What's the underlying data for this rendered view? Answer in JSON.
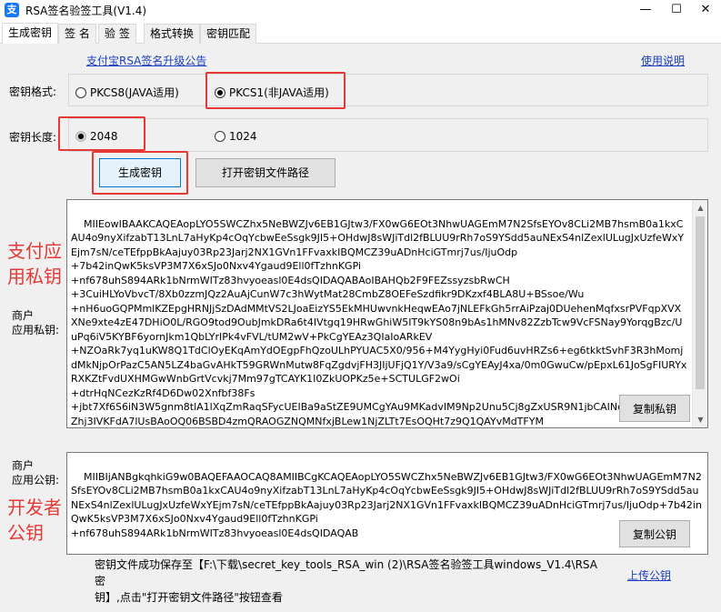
{
  "window": {
    "title": "RSA签名验签工具(V1.4)",
    "minimize": "—",
    "maximize": "☐",
    "close": "✕"
  },
  "tabs": [
    "生成密钥",
    "签  名",
    "验  签",
    "格式转换",
    "密钥匹配"
  ],
  "links": {
    "upgrade_notice": "支付宝RSA签名升级公告",
    "manual": "使用说明",
    "upload": "上传公钥"
  },
  "key_format": {
    "label": "密钥格式:",
    "options": [
      "PKCS8(JAVA适用)",
      "PKCS1(非JAVA适用)"
    ],
    "selected": "PKCS1(非JAVA适用)"
  },
  "key_length": {
    "label": "密钥长度:",
    "options": [
      "2048",
      "1024"
    ],
    "selected": "2048"
  },
  "buttons": {
    "generate": "生成密钥",
    "open_path": "打开密钥文件路径",
    "copy_private": "复制私钥",
    "copy_public": "复制公钥"
  },
  "private_key": {
    "label_line1": "商户",
    "label_line2": "应用私钥:",
    "value": "MIIEowIBAAKCAQEAopLYO5SWCZhx5NeBWZJv6EB1GJtw3/FX0wG6EOt3NhwUAGEmM7N2SfsEYOv8CLi2MB7hsmB0a1kxCAU4o9nyXifzabT13LnL7aHyKp4cOqYcbwEeSsgk9JI5+OHdwJ8sWJiTdl2fBLUU9rRh7oS9YSdd5auNExS4nlZexlULugJxUzfeWxYEjm7sN/ceTEfppBkAajuy03Rp23Jarj2NX1GVn1FFvaxkIBQMCZ39uADnHciGTmrj7us/IjuOdp\n+7b42inQwK5ksVP3M7X6xSJo0Nxv4Ygaud9Ell0fTzhnKGPi\n+nf678uhS894ARk1bNrmWITz83hvyoeasl0E4dsQIDAQABAoIBAHQb2F9FEZssyzsbRwCH\n+3CuiHLYoVbvcT/8Xb0zzmJQz2AuAjCunW7c3hWytMat28CmbZ8OEFeSzdfikr9DKzxf4BLA8U+BSsoe/Wu\n+nH6uoGQPMmlKZEpgHRNJjSzDAdMMtVS2LJoaEizYS5EkMHUwvnkHeqwEAo7jNLEFkGh5rrAiPzaj0DUehenMqfxsrPVFqpXVXXNe9xte4zE47DHiO0L/RGO9tod9OubJmkDRa6t4IVtgq19HRwGhiW5IT9kYS08n9bAs1hMNv82ZzbTcw9VcFSNay9YorqgBzc/UuPq6iV5KYBF6yornJkm1QbLYrIPk4vFVL/tUM2wV+PkCgYEAz3QIaIoARkEV\n+NZOaRk7yq1uKW8Q1TdClOyEKqAmYdOEgpFhQzoULhPYUAC5X0/956+M4YygHyi0Fud6uvHRZs6+eg6tkktSvhF3R3hMomjdMkNjpOrPazC5AN5LZ4baGvAHkT59GRWnMutw8FqZgdvjFH3JIjUFjQ1Y/V3a9/sCgYEAyJ4xa/0m0GwuCw/pEpxL61JoSgFIURYxRXKZtFvdUXHMGwWnbGrtVcvkj7Mm97gTCAYK1I0ZkUOPKz5e+SCTULGF2wOi\n+dtrHqNCezKzRf4D6Dw02Xnfbf38Fs\n+jbt7Xf6S6iN3W5gnm8tlA1lXqZmRaqSFycUEIBa9aStZE9UMCgYAu9MKadvIM9Np2Unu5Cj8gZxUSR9N1jbCAINcPgJZs/uroxkZhj3IVKFdA7lUsBAoOQ06BSBD4zmQRAOGZNQMNfxjBLew1NjZLTt7EsOQHt7z9Q1QAYvMdTFYM"
  },
  "public_key": {
    "label_line1": "商户",
    "label_line2": "应用公钥:",
    "value": "MIIBIjANBgkqhkiG9w0BAQEFAAOCAQ8AMIIBCgKCAQEAopLYO5SWCZhx5NeBWZJv6EB1GJtw3/FX0wG6EOt3NhwUAGEmM7N2SfsEYOv8CLi2MB7hsmB0a1kxCAU4o9nyXifzabT13LnL7aHyKp4cOqYcbwEeSsgk9JI5+OHdwJ8sWJiTdl2fBLUU9rRh7oS9YSdd5auNExS4nlZexlULugJxUzfeWxYEjm7sN/ceTEfppBkAajuy03Rp23Jarj2NX1GVn1FFvaxkIBQMCZ39uADnHciGTmrj7us/IjuOdp+7b42inQwK5ksVP3M7X6xSJo0Nxv4Ygaud9Ell0fTzhnKGPi\n+nf678uhS894ARk1bNrmWITz83hvyoeasl0E4dsQIDAQAB"
  },
  "annotations": {
    "private_line1": "支付应",
    "private_line2": "用私钥",
    "public_line1": "开发者",
    "public_line2": "公钥"
  },
  "status": {
    "line1": "密钥文件成功保存至【F:\\下载\\secret_key_tools_RSA_win (2)\\RSA签名验签工具windows_V1.4\\RSA密",
    "line2": "钥】,点击\"打开密钥文件路径\"按钮查看"
  },
  "colors": {
    "accent": "#1a3ebf",
    "highlight": "#e53935",
    "panel": "#f0f0f0"
  }
}
